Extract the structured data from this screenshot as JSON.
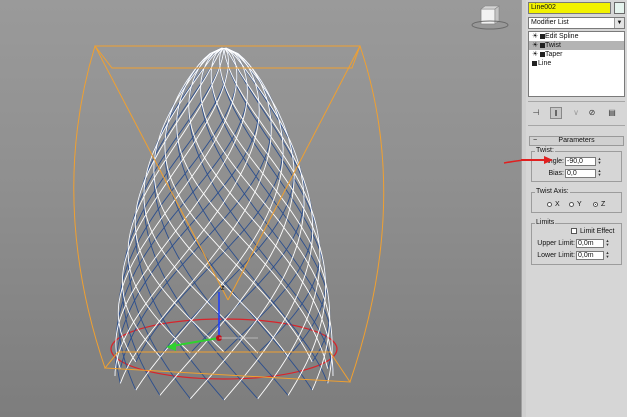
{
  "object_name": "Line002",
  "modifier_list_label": "Modifier List",
  "stack": [
    {
      "label": "Edit Spline",
      "selected": false
    },
    {
      "label": "Twist",
      "selected": true
    },
    {
      "label": "Taper",
      "selected": false
    }
  ],
  "stack_base": "Line",
  "parameters": {
    "title": "Parameters",
    "twist_group": "Twist:",
    "angle_label": "Angle:",
    "angle_value": "-90,0",
    "bias_label": "Bias:",
    "bias_value": "0,0",
    "axis_group": "Twist Axis:",
    "axes": [
      {
        "label": "X",
        "selected": false
      },
      {
        "label": "Y",
        "selected": false
      },
      {
        "label": "Z",
        "selected": true
      }
    ],
    "limits_group": "Limits",
    "limit_effect_label": "Limit Effect",
    "upper_limit_label": "Upper Limit:",
    "upper_limit_value": "0,0m",
    "lower_limit_label": "Lower Limit:",
    "lower_limit_value": "0,0m"
  },
  "gizmo_label": "z",
  "colors": {
    "highlight": "#f2f200",
    "gizmo": "#f0a030",
    "wire_white": "#ffffff",
    "wire_blue": "#2c4f8e",
    "base_ellipse": "#d8242b",
    "annotation_arrow": "#e02020"
  }
}
